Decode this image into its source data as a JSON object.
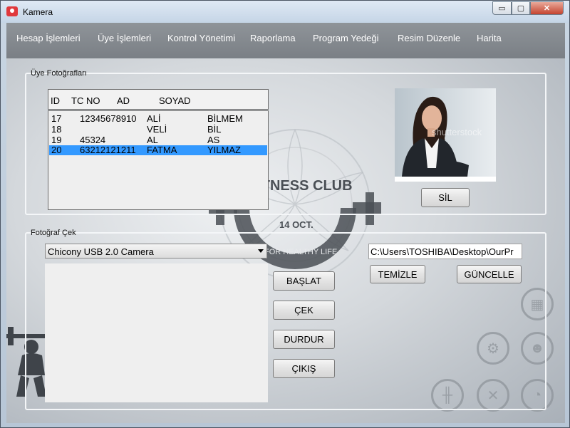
{
  "window": {
    "title": "Kamera",
    "controls": {
      "minimize": "▭",
      "maximize": "▢",
      "close": "✕"
    }
  },
  "menu": [
    "Hesap İşlemleri",
    "Üye İşlemleri",
    "Kontrol Yönetimi",
    "Raporlama",
    "Program Yedeği",
    "Resim Düzenle",
    "Harita"
  ],
  "member_photos": {
    "label": "Üye Fotoğrafları",
    "columns": [
      "ID",
      "TC NO",
      "AD",
      "SOYAD"
    ],
    "rows": [
      {
        "id": "17",
        "tc": "12345678910",
        "ad": "ALİ",
        "soyad": "BİLMEM"
      },
      {
        "id": "18",
        "tc": "",
        "ad": "VELİ",
        "soyad": "BİL"
      },
      {
        "id": "19",
        "tc": "45324",
        "ad": "AL",
        "soyad": "AS"
      },
      {
        "id": "20",
        "tc": "63212121211",
        "ad": "FATMA",
        "soyad": "YILMAZ",
        "selected": true
      }
    ],
    "delete_button": "SİL",
    "photo_watermark": "shutterstock"
  },
  "take_photo": {
    "label": "Fotoğraf Çek",
    "camera_select": "Chicony USB 2.0 Camera",
    "path_value": "C:\\Users\\TOSHIBA\\Desktop\\OurPr",
    "buttons": {
      "start": "BAŞLAT",
      "capture": "ÇEK",
      "stop": "DURDUR",
      "exit": "ÇIKIŞ",
      "clear": "TEMİZLE",
      "update": "GÜNCELLE"
    }
  },
  "background": {
    "club_name": "FITNESS CLUB",
    "club_date": "14 OCT.",
    "club_slogan": "FOR HEALTHY LIFE"
  },
  "colors": {
    "selection": "#3399ff",
    "menubar": "#858a90",
    "accent_close": "#c4432e"
  }
}
